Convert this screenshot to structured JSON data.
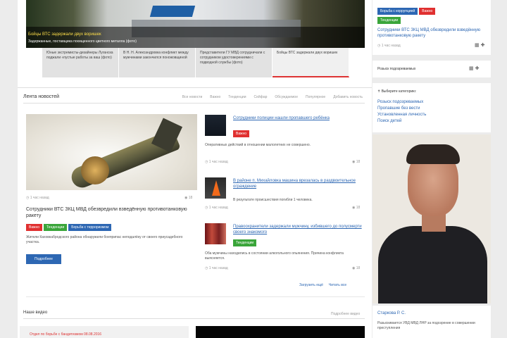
{
  "hero": {
    "caption1": "Бойцы ВТС задержали двух воришек",
    "caption2": "Задержанные, поставщика похищенного цветного металла (фото)"
  },
  "thumbs": [
    "Юные экстремисты-дизайнеры Луганска поджали «пустые работы за ваш (фото)",
    "В Н. Н. Александровка конфликт между мужчинами закончился поножовщиной",
    "Представители ГУ МВД сотрудничали с сотрудником удостоверениями с подводной службы (фото)",
    "Бойцы ВТС задержали двух воришек"
  ],
  "feed": {
    "title": "Лента новостей",
    "tabs": [
      "Все новости",
      "Важно",
      "Тенденции",
      "Сейфар",
      "Обсуждаемое",
      "Популярное",
      "Добавить новость"
    ],
    "main": {
      "meta_time": "1 час назад",
      "meta_views": "18",
      "title": "Сотрудники ВТС ЗКЦ МВД обезвредили взведённую противотанковую ракету",
      "badges": [
        "Важно",
        "Тенденции",
        "Борьба с терроризмом"
      ],
      "text": "Жители Каховкабродского района обнаружили боеприпас неподалёку от своего приусадебного участка.",
      "more": "Подробнее"
    },
    "items": [
      {
        "title": "Сотрудники полиции нашли пропавшего ребёнка",
        "badge": "Важно",
        "text": "Оперативных действий в отношении малолетних не совершено.",
        "meta": "1 час назад",
        "views": "18"
      },
      {
        "title": "В районе п. Михайловка машина врезалась в раздвоительное ограждение",
        "text": "В результате происшествия погибли 1 человека.",
        "meta": "1 час назад",
        "views": "18"
      },
      {
        "title": "Правоохранители задержали мужчину, избившего до полусмерти своего знакомого",
        "badge": "Тенденции",
        "text": "Оба мужчины находились в состоянии алкогольного опьянения. Причина конфликта выясняется.",
        "meta": "1 час назад",
        "views": "18"
      }
    ],
    "load_more": "Загрузить ещё",
    "read_all": "Читать все"
  },
  "video": {
    "title": "Наше видео",
    "all_link": "Подробнее видео",
    "clip1": "Отдел по борьбе с бандитизмом 08.08.2016"
  },
  "sidebar": {
    "badges": [
      "Борьба с коррупцией",
      "Важно",
      "Тенденции"
    ],
    "news_title": "Сотрудники ВТС ЗКЦ МВД обезвредили взведённую противотанковую ракету",
    "news_meta": "1 час назад",
    "search_title": "Розыск подозреваемых",
    "categories_title": "Выберите категорию:",
    "categories": [
      "Розыск подозреваемых",
      "Пропавшие без вести",
      "Установленная личность",
      "Поиск детей"
    ],
    "person_name": "Старкова Р. С.",
    "person_desc": "Разыскивается УВД МВД ЛНР за подозрение в совершении преступления"
  }
}
